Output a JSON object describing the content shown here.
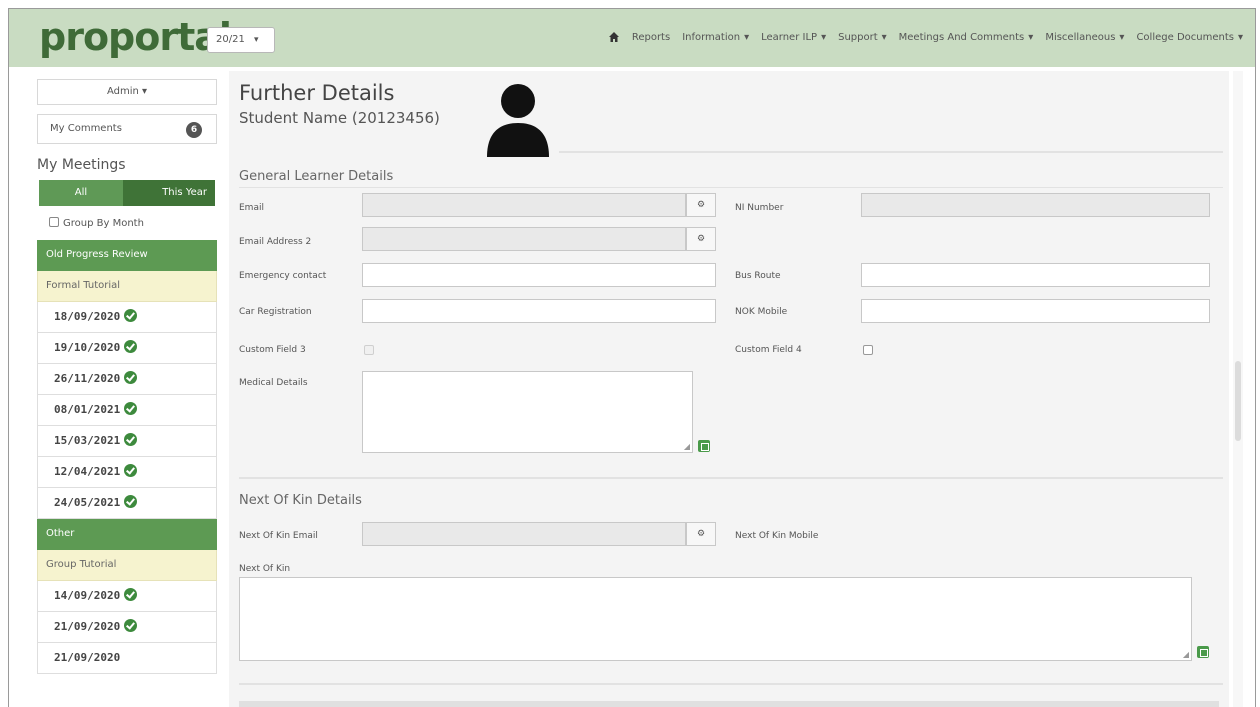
{
  "header": {
    "logo_text": "prop",
    "logo_text_tail": "rtal",
    "year": "20/21",
    "nav": [
      {
        "label": "Reports",
        "dropdown": false
      },
      {
        "label": "Information",
        "dropdown": true
      },
      {
        "label": "Learner ILP",
        "dropdown": true
      },
      {
        "label": "Support",
        "dropdown": true
      },
      {
        "label": "Meetings And Comments",
        "dropdown": true
      },
      {
        "label": "Miscellaneous",
        "dropdown": true
      },
      {
        "label": "College Documents",
        "dropdown": true
      }
    ],
    "caret": "▾"
  },
  "sidebar": {
    "admin_label": "Admin ▾",
    "comments_label": "My Comments",
    "comments_count": "6",
    "meetings_title": "My Meetings",
    "filter_all": "All",
    "filter_year": "This Year",
    "group_by_label": "Group By Month",
    "groups": [
      {
        "header": "Old Progress Review",
        "sub": "Formal Tutorial",
        "dates": [
          {
            "date": "18/09/2020",
            "done": true
          },
          {
            "date": "19/10/2020",
            "done": true
          },
          {
            "date": "26/11/2020",
            "done": true
          },
          {
            "date": "08/01/2021",
            "done": true
          },
          {
            "date": "15/03/2021",
            "done": true
          },
          {
            "date": "12/04/2021",
            "done": true
          },
          {
            "date": "24/05/2021",
            "done": true
          }
        ]
      },
      {
        "header": "Other",
        "sub": "Group Tutorial",
        "dates": [
          {
            "date": "14/09/2020",
            "done": true
          },
          {
            "date": "21/09/2020",
            "done": true
          },
          {
            "date": "21/09/2020",
            "done": false
          }
        ]
      }
    ]
  },
  "main": {
    "title": "Further Details",
    "student": "Student Name (20123456)",
    "general_section": "General Learner Details",
    "labels": {
      "email": "Email",
      "ni_number": "NI Number",
      "email2": "Email Address 2",
      "emergency": "Emergency contact",
      "bus_route": "Bus Route",
      "car_reg": "Car Registration",
      "nok_mobile": "NOK Mobile",
      "custom3": "Custom Field 3",
      "custom4": "Custom Field 4",
      "medical": "Medical Details"
    },
    "nok_section": "Next Of Kin Details",
    "nok_labels": {
      "nok_email": "Next Of Kin Email",
      "nok_mobile": "Next Of Kin Mobile",
      "nok": "Next Of Kin"
    },
    "gear": "⚙"
  }
}
